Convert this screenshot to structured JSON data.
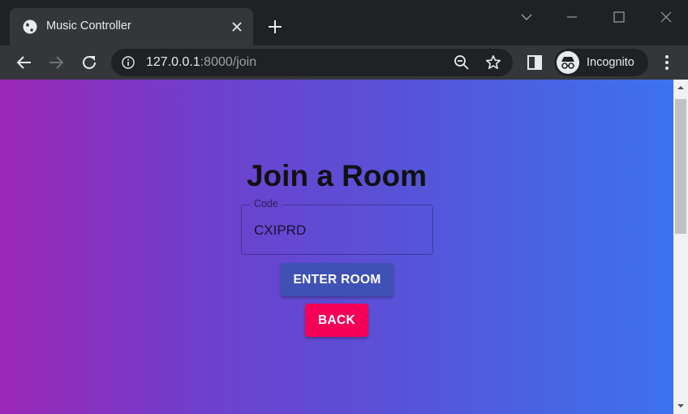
{
  "tab": {
    "title": "Music Controller"
  },
  "address_bar": {
    "host": "127.0.0.1",
    "path": ":8000/join"
  },
  "profile": {
    "label": "Incognito"
  },
  "page": {
    "title": "Join a Room",
    "code_field": {
      "label": "Code",
      "value": "CXIPRD"
    },
    "enter_button": "ENTER ROOM",
    "back_button": "BACK"
  },
  "colors": {
    "enter_button": "#3f51b5",
    "back_button": "#f50057",
    "gradient_start": "#9b27b5",
    "gradient_end": "#3d72ee"
  }
}
